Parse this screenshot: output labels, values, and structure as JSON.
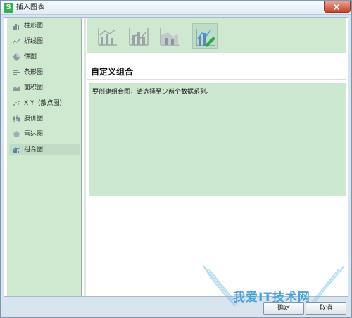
{
  "window": {
    "title": "插入图表"
  },
  "sidebar": {
    "items": [
      {
        "label": "柱形图",
        "icon": "column-chart-icon"
      },
      {
        "label": "折线图",
        "icon": "line-chart-icon"
      },
      {
        "label": "饼图",
        "icon": "pie-chart-icon"
      },
      {
        "label": "条形图",
        "icon": "bar-chart-icon"
      },
      {
        "label": "面积图",
        "icon": "area-chart-icon"
      },
      {
        "label": "X Y（散点图）",
        "icon": "scatter-chart-icon"
      },
      {
        "label": "股价图",
        "icon": "stock-chart-icon"
      },
      {
        "label": "雷达图",
        "icon": "radar-chart-icon"
      },
      {
        "label": "组合图",
        "icon": "combo-chart-icon",
        "selected": true
      }
    ]
  },
  "main": {
    "subtypes": [
      {
        "icon": "combo-clustered-column-line-icon"
      },
      {
        "icon": "combo-column-line-secondary-axis-icon"
      },
      {
        "icon": "combo-stacked-area-column-icon"
      },
      {
        "icon": "combo-custom-icon",
        "selected": true
      }
    ],
    "section_title": "自定义组合",
    "description": "要创建组合图，请选择至少两个数据系列。"
  },
  "buttons": {
    "ok": "确定",
    "cancel": "取消"
  },
  "watermark": {
    "text": "我爱IT技术网"
  },
  "colors": {
    "sidebar_bg": "#cfe8d0",
    "accent_blue": "#4aa3d8",
    "selected_bg": "#c1dcc6"
  }
}
